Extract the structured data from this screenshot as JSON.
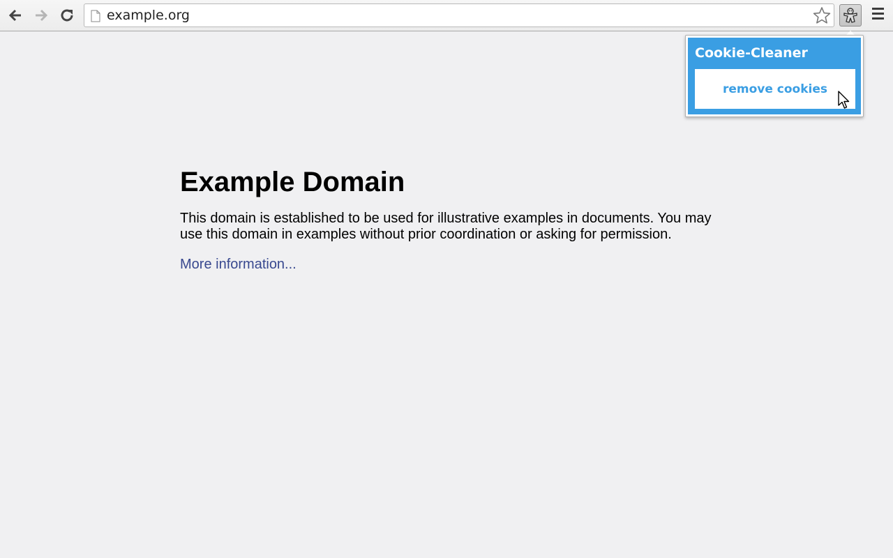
{
  "browser": {
    "url": "example.org",
    "icons": {
      "back": "back-arrow-icon",
      "forward": "forward-arrow-icon",
      "reload": "reload-icon",
      "page": "page-icon",
      "bookmark": "star-icon",
      "extension": "cookie-icon",
      "menu": "hamburger-menu-icon"
    }
  },
  "page": {
    "heading": "Example Domain",
    "paragraph": "This domain is established to be used for illustrative examples in documents. You may use this domain in examples without prior coordination or asking for permission.",
    "link": "More information..."
  },
  "popup": {
    "title": "Cookie-Cleaner",
    "button_label": "remove cookies",
    "accent_color": "#3a9ee3"
  }
}
